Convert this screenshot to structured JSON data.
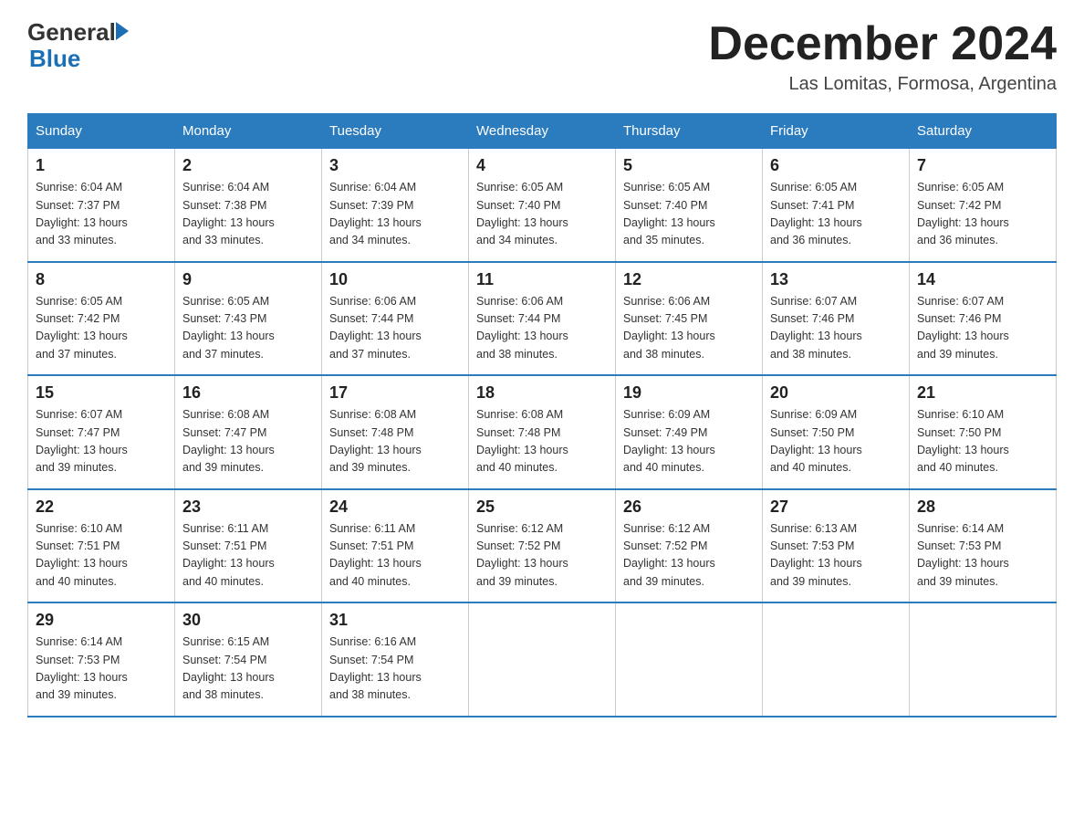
{
  "header": {
    "logo_general": "General",
    "logo_blue": "Blue",
    "month_title": "December 2024",
    "location": "Las Lomitas, Formosa, Argentina"
  },
  "days_of_week": [
    "Sunday",
    "Monday",
    "Tuesday",
    "Wednesday",
    "Thursday",
    "Friday",
    "Saturday"
  ],
  "weeks": [
    [
      {
        "day": "1",
        "sunrise": "6:04 AM",
        "sunset": "7:37 PM",
        "daylight": "13 hours and 33 minutes."
      },
      {
        "day": "2",
        "sunrise": "6:04 AM",
        "sunset": "7:38 PM",
        "daylight": "13 hours and 33 minutes."
      },
      {
        "day": "3",
        "sunrise": "6:04 AM",
        "sunset": "7:39 PM",
        "daylight": "13 hours and 34 minutes."
      },
      {
        "day": "4",
        "sunrise": "6:05 AM",
        "sunset": "7:40 PM",
        "daylight": "13 hours and 34 minutes."
      },
      {
        "day": "5",
        "sunrise": "6:05 AM",
        "sunset": "7:40 PM",
        "daylight": "13 hours and 35 minutes."
      },
      {
        "day": "6",
        "sunrise": "6:05 AM",
        "sunset": "7:41 PM",
        "daylight": "13 hours and 36 minutes."
      },
      {
        "day": "7",
        "sunrise": "6:05 AM",
        "sunset": "7:42 PM",
        "daylight": "13 hours and 36 minutes."
      }
    ],
    [
      {
        "day": "8",
        "sunrise": "6:05 AM",
        "sunset": "7:42 PM",
        "daylight": "13 hours and 37 minutes."
      },
      {
        "day": "9",
        "sunrise": "6:05 AM",
        "sunset": "7:43 PM",
        "daylight": "13 hours and 37 minutes."
      },
      {
        "day": "10",
        "sunrise": "6:06 AM",
        "sunset": "7:44 PM",
        "daylight": "13 hours and 37 minutes."
      },
      {
        "day": "11",
        "sunrise": "6:06 AM",
        "sunset": "7:44 PM",
        "daylight": "13 hours and 38 minutes."
      },
      {
        "day": "12",
        "sunrise": "6:06 AM",
        "sunset": "7:45 PM",
        "daylight": "13 hours and 38 minutes."
      },
      {
        "day": "13",
        "sunrise": "6:07 AM",
        "sunset": "7:46 PM",
        "daylight": "13 hours and 38 minutes."
      },
      {
        "day": "14",
        "sunrise": "6:07 AM",
        "sunset": "7:46 PM",
        "daylight": "13 hours and 39 minutes."
      }
    ],
    [
      {
        "day": "15",
        "sunrise": "6:07 AM",
        "sunset": "7:47 PM",
        "daylight": "13 hours and 39 minutes."
      },
      {
        "day": "16",
        "sunrise": "6:08 AM",
        "sunset": "7:47 PM",
        "daylight": "13 hours and 39 minutes."
      },
      {
        "day": "17",
        "sunrise": "6:08 AM",
        "sunset": "7:48 PM",
        "daylight": "13 hours and 39 minutes."
      },
      {
        "day": "18",
        "sunrise": "6:08 AM",
        "sunset": "7:48 PM",
        "daylight": "13 hours and 40 minutes."
      },
      {
        "day": "19",
        "sunrise": "6:09 AM",
        "sunset": "7:49 PM",
        "daylight": "13 hours and 40 minutes."
      },
      {
        "day": "20",
        "sunrise": "6:09 AM",
        "sunset": "7:50 PM",
        "daylight": "13 hours and 40 minutes."
      },
      {
        "day": "21",
        "sunrise": "6:10 AM",
        "sunset": "7:50 PM",
        "daylight": "13 hours and 40 minutes."
      }
    ],
    [
      {
        "day": "22",
        "sunrise": "6:10 AM",
        "sunset": "7:51 PM",
        "daylight": "13 hours and 40 minutes."
      },
      {
        "day": "23",
        "sunrise": "6:11 AM",
        "sunset": "7:51 PM",
        "daylight": "13 hours and 40 minutes."
      },
      {
        "day": "24",
        "sunrise": "6:11 AM",
        "sunset": "7:51 PM",
        "daylight": "13 hours and 40 minutes."
      },
      {
        "day": "25",
        "sunrise": "6:12 AM",
        "sunset": "7:52 PM",
        "daylight": "13 hours and 39 minutes."
      },
      {
        "day": "26",
        "sunrise": "6:12 AM",
        "sunset": "7:52 PM",
        "daylight": "13 hours and 39 minutes."
      },
      {
        "day": "27",
        "sunrise": "6:13 AM",
        "sunset": "7:53 PM",
        "daylight": "13 hours and 39 minutes."
      },
      {
        "day": "28",
        "sunrise": "6:14 AM",
        "sunset": "7:53 PM",
        "daylight": "13 hours and 39 minutes."
      }
    ],
    [
      {
        "day": "29",
        "sunrise": "6:14 AM",
        "sunset": "7:53 PM",
        "daylight": "13 hours and 39 minutes."
      },
      {
        "day": "30",
        "sunrise": "6:15 AM",
        "sunset": "7:54 PM",
        "daylight": "13 hours and 38 minutes."
      },
      {
        "day": "31",
        "sunrise": "6:16 AM",
        "sunset": "7:54 PM",
        "daylight": "13 hours and 38 minutes."
      },
      null,
      null,
      null,
      null
    ]
  ],
  "labels": {
    "sunrise": "Sunrise:",
    "sunset": "Sunset:",
    "daylight": "Daylight:"
  },
  "colors": {
    "header_bg": "#2b7bbf",
    "border": "#2b7bbf",
    "accent": "#1a6fb5"
  }
}
